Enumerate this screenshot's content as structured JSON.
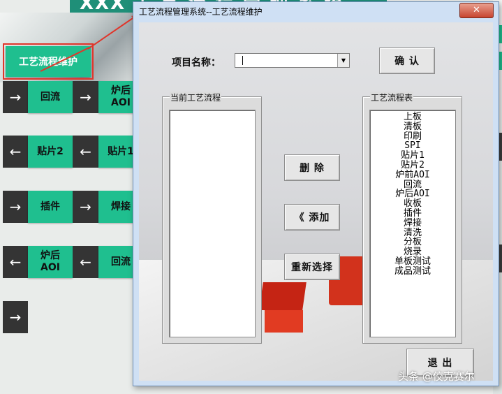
{
  "background": {
    "banner_text": "XXX 工 艺 流 程 管 理 系 统",
    "main_button": "工艺流程维护",
    "rows": [
      [
        "→",
        "回流",
        "→",
        "炉后\nAOI"
      ],
      [
        "←",
        "贴片2",
        "←",
        "贴片1"
      ],
      [
        "→",
        "插件",
        "→",
        "焊接"
      ],
      [
        "←",
        "炉后\nAOI",
        "←",
        "回流"
      ],
      [
        "→"
      ]
    ]
  },
  "dialog": {
    "title": "工艺流程管理系统--工艺流程维护",
    "close_symbol": "✕",
    "project_label": "项目名称：",
    "project_value": "",
    "confirm_label": "确 认",
    "current_flow_title": "当前工艺流程",
    "current_flow_items": [],
    "flow_table_title": "工艺流程表",
    "flow_table_items": [
      "上板",
      "清板",
      "印刷",
      "SPI",
      "贴片1",
      "贴片2",
      "炉前AOI",
      "回流",
      "炉后AOI",
      "收板",
      "插件",
      "焊接",
      "清洗",
      "分板",
      "烧录",
      "单板测试",
      "成品测试"
    ],
    "delete_label": "删 除",
    "add_label": "《 添加",
    "reselect_label": "重新选择",
    "exit_label": "退 出"
  },
  "watermark": "头条 @佼克赛尔",
  "colors": {
    "accent_green": "#1fbf8f",
    "dark_cell": "#343434",
    "highlight_red": "#e0362b"
  }
}
